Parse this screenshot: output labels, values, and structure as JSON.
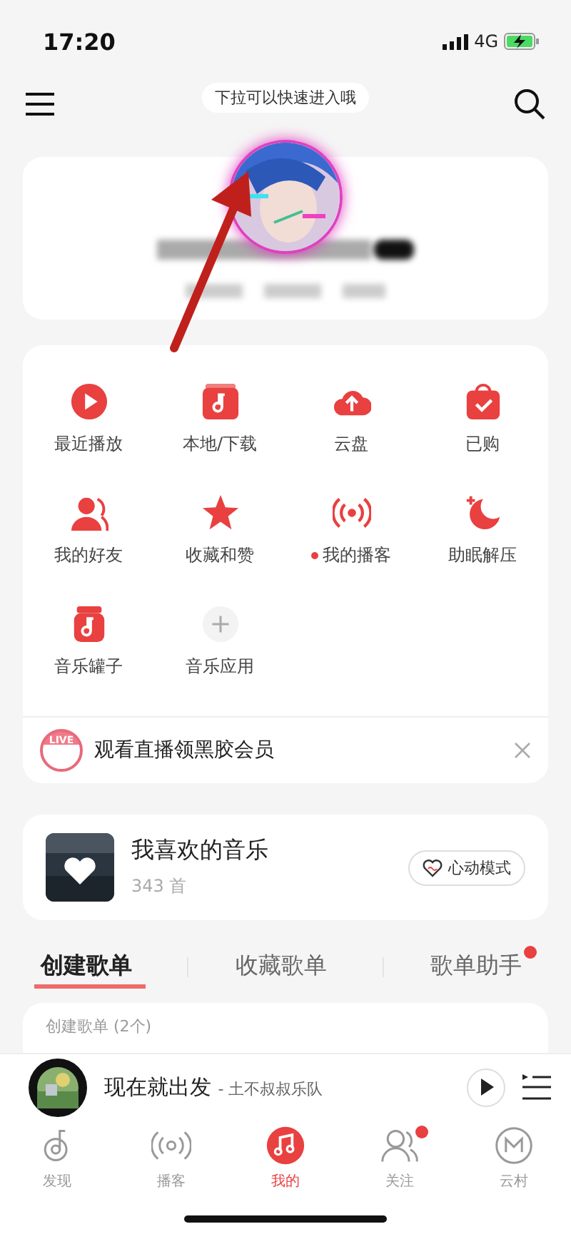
{
  "status_bar": {
    "time": "17:20",
    "network": "4G"
  },
  "header": {
    "hint": "下拉可以快速进入哦"
  },
  "shortcuts": [
    {
      "kind": "play",
      "label": "最近播放",
      "new": false
    },
    {
      "kind": "album",
      "label": "本地/下载",
      "new": false
    },
    {
      "kind": "cloud",
      "label": "云盘",
      "new": false
    },
    {
      "kind": "bag",
      "label": "已购",
      "new": false
    },
    {
      "kind": "friends",
      "label": "我的好友",
      "new": false
    },
    {
      "kind": "star",
      "label": "收藏和赞",
      "new": false
    },
    {
      "kind": "podcast",
      "label": "我的播客",
      "new": true
    },
    {
      "kind": "moon",
      "label": "助眠解压",
      "new": false
    },
    {
      "kind": "jar",
      "label": "音乐罐子",
      "new": false
    },
    {
      "kind": "add",
      "label": "音乐应用",
      "new": false
    }
  ],
  "promo": {
    "badge": "LIVE",
    "text": "观看直播领黑胶会员"
  },
  "liked": {
    "title": "我喜欢的音乐",
    "count": "343 首",
    "button": "心动模式"
  },
  "playlist_tabs": [
    {
      "label": "创建歌单",
      "selected": true,
      "new": false
    },
    {
      "label": "收藏歌单",
      "selected": false,
      "new": false
    },
    {
      "label": "歌单助手",
      "selected": false,
      "new": true
    }
  ],
  "playlists": {
    "title": "创建歌单 (2个)"
  },
  "player": {
    "title": "现在就出发",
    "artist": "- 土不叔叔乐队"
  },
  "nav": [
    {
      "kind": "discover",
      "label": "发现",
      "selected": false,
      "new": false
    },
    {
      "kind": "podcast",
      "label": "播客",
      "selected": false,
      "new": false
    },
    {
      "kind": "mine",
      "label": "我的",
      "selected": true,
      "new": false
    },
    {
      "kind": "follow",
      "label": "关注",
      "selected": false,
      "new": true
    },
    {
      "kind": "village",
      "label": "云村",
      "selected": false,
      "new": false
    }
  ]
}
